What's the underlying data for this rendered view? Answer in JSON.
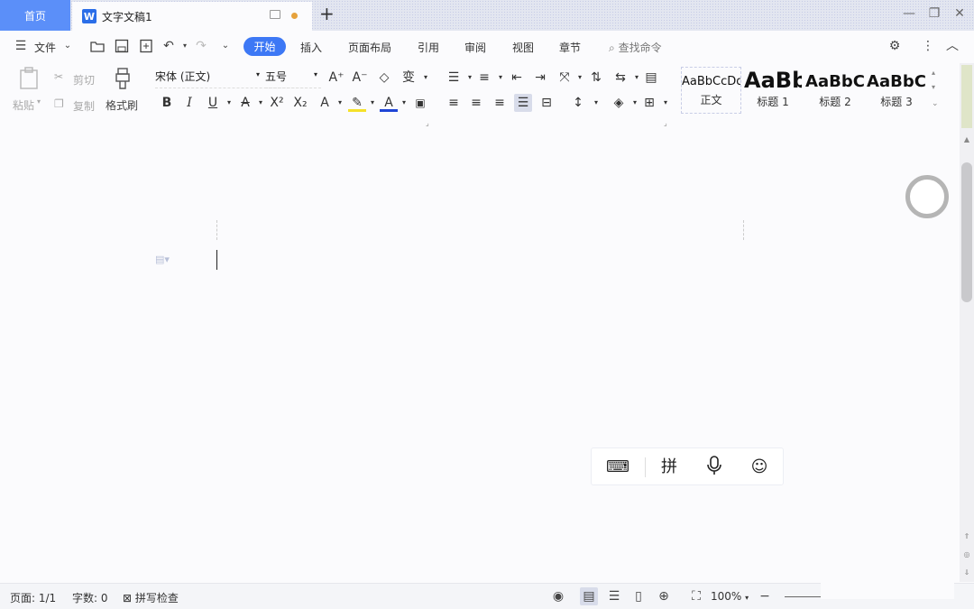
{
  "tabs": {
    "home_label": "首页",
    "doc_logo": "W",
    "doc_title": "文字文稿1",
    "add_icon": "+"
  },
  "menu": {
    "file_label": "文件",
    "items": [
      "开始",
      "插入",
      "页面布局",
      "引用",
      "审阅",
      "视图",
      "章节"
    ],
    "active_index": 0,
    "search_label": "查找命令"
  },
  "ribbon": {
    "paste_label": "粘贴",
    "cut_label": "剪切",
    "copy_label": "复制",
    "format_painter_label": "格式刷",
    "font_name": "宋体 (正文)",
    "font_size": "五号",
    "styles": [
      {
        "sample": "AaBbCcDd",
        "caption": "正文"
      },
      {
        "sample": "AaBb",
        "caption": "标题 1"
      },
      {
        "sample": "AaBbC",
        "caption": "标题 2"
      },
      {
        "sample": "AaBbC",
        "caption": "标题 3"
      }
    ]
  },
  "ime": {
    "pinyin_label": "拼"
  },
  "status": {
    "page": "页面: 1/1",
    "word_count": "字数: 0",
    "spell_check": "拼写检查",
    "zoom": "100%"
  },
  "colors": {
    "accent": "#3d78f5",
    "home_tab": "#5b8ff9",
    "highlight_yellow": "#f5e12a",
    "font_color_blue": "#1f45d6"
  }
}
